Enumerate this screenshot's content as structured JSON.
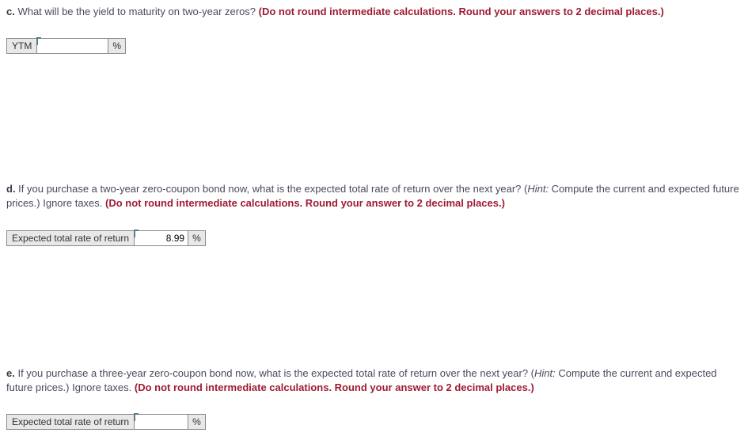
{
  "c": {
    "label": "c.",
    "question": " What will be the yield to maturity on two-year zeros? ",
    "instruction": "(Do not round intermediate calculations. Round your answers to 2 decimal places.)",
    "answer_label": "YTM",
    "answer_value": "",
    "unit": "%"
  },
  "d": {
    "label": "d.",
    "question": " If you purchase a two-year zero-coupon bond now, what is the expected total rate of return over the next year? (",
    "hint_label": "Hint:",
    "hint_text": " Compute the current and expected future prices.) Ignore taxes. ",
    "instruction": "(Do not round intermediate calculations. Round your answer to 2 decimal places.)",
    "answer_label": "Expected total rate of return",
    "answer_value": "8.99",
    "unit": "%"
  },
  "e": {
    "label": "e.",
    "question": " If you purchase a three-year zero-coupon bond now, what is the expected total rate of return over the next year? (",
    "hint_label": "Hint:",
    "hint_text": " Compute the current and expected future prices.) Ignore taxes. ",
    "instruction": "(Do not round intermediate calculations. Round your answer to 2 decimal places.)",
    "answer_label": "Expected total rate of return",
    "answer_value": "",
    "unit": "%"
  }
}
